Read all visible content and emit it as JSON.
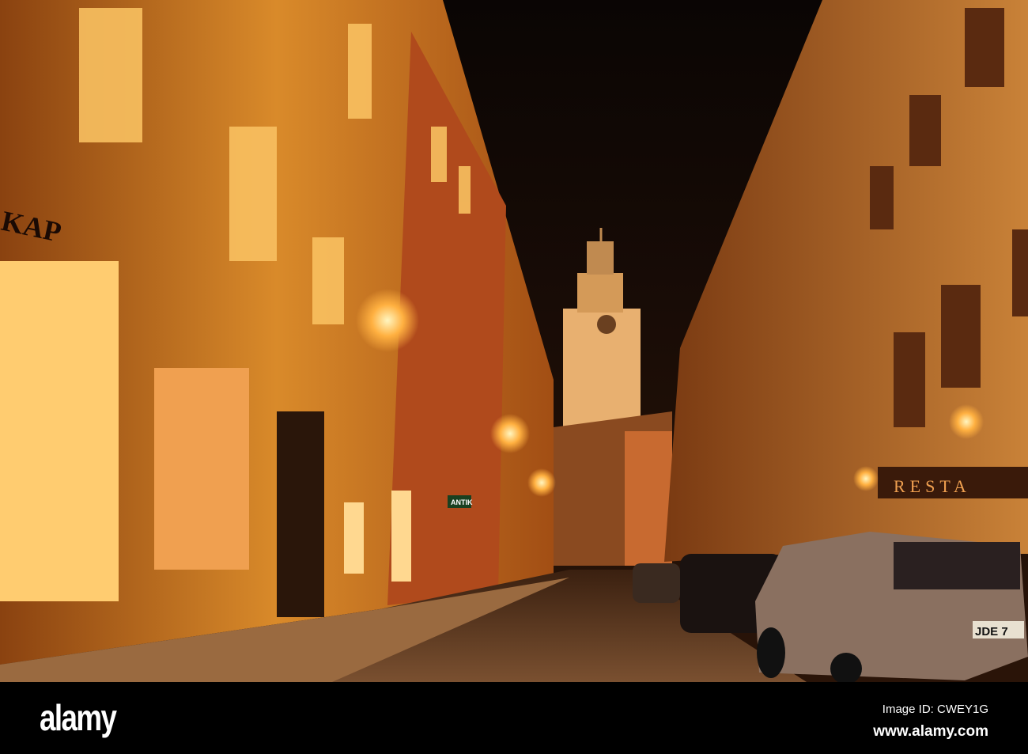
{
  "photo": {
    "shop_sign_left": "KAP",
    "shop_sign_antik": "ANTIK",
    "shop_sign_right": "RESTA",
    "license_plate": "JDE 7"
  },
  "watermark": {
    "logo": "alamy",
    "image_id": "Image ID: CWEY1G",
    "url": "www.alamy.com"
  },
  "colors": {
    "sky": "#0d0604",
    "facade": "#c9751e",
    "glow": "#ffd070"
  }
}
